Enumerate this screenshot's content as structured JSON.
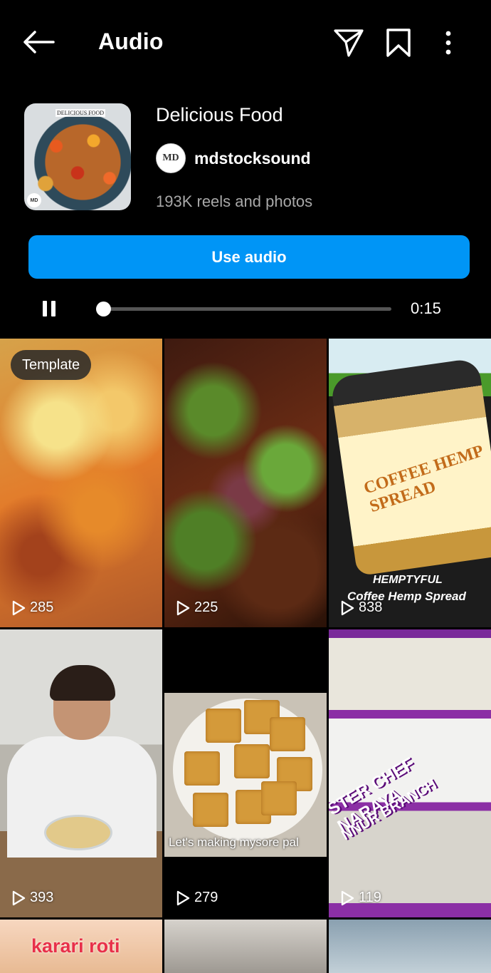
{
  "header": {
    "title": "Audio",
    "back_icon": "arrow-left-icon",
    "share_icon": "paper-plane-icon",
    "save_icon": "bookmark-icon",
    "more_icon": "more-vertical-icon"
  },
  "audio": {
    "cover_label": "DELICIOUS FOOD",
    "cover_badge": "MD",
    "track_name": "Delicious Food",
    "artist_avatar": "MD",
    "artist": "mdstocksound",
    "reels_count": "193K reels and photos",
    "use_audio_label": "Use audio"
  },
  "player": {
    "state": "playing",
    "progress": 0.0,
    "duration": "0:15"
  },
  "grid": [
    {
      "views": "285",
      "badge": "Template"
    },
    {
      "views": "225"
    },
    {
      "views": "838",
      "caption_1": "HEMPTYFUL",
      "caption_2": "Coffee Hemp Spread",
      "product_text": "COFFEE HEMP SPREAD"
    },
    {
      "views": "393"
    },
    {
      "views": "279",
      "caption": "Let's making mysore pal"
    },
    {
      "views": "119",
      "overlay_1": "STER CHEF NARAYA",
      "overlay_2": "NNUR BRANCH"
    },
    {
      "caption": "karari roti"
    },
    {},
    {}
  ],
  "colors": {
    "accent": "#0095f6",
    "background": "#000000",
    "muted_text": "#a8a8a8"
  }
}
